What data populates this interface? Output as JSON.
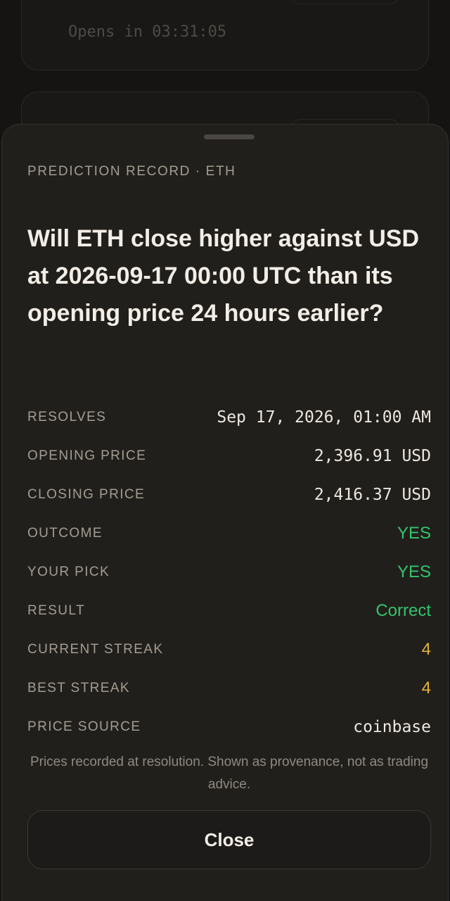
{
  "background": {
    "card1_timer": "Opens in 03:31:05"
  },
  "sheet": {
    "eyebrow": "PREDICTION RECORD · ETH",
    "question": "Will ETH close higher against USD at 2026-09-17 00:00 UTC than its opening price 24 hours earlier?",
    "rows": [
      {
        "label": "RESOLVES",
        "value": "Sep 17, 2026, 01:00 AM"
      },
      {
        "label": "OPENING PRICE",
        "value": "2,396.91 USD"
      },
      {
        "label": "CLOSING PRICE",
        "value": "2,416.37 USD"
      },
      {
        "label": "OUTCOME",
        "value": "YES"
      },
      {
        "label": "YOUR PICK",
        "value": "YES"
      },
      {
        "label": "RESULT",
        "value": "Correct"
      },
      {
        "label": "CURRENT STREAK",
        "value": "4"
      },
      {
        "label": "BEST STREAK",
        "value": "4"
      },
      {
        "label": "PRICE SOURCE",
        "value": "coinbase"
      }
    ],
    "note": "Prices recorded at resolution. Shown as provenance, not as trading advice.",
    "close_label": "Close"
  },
  "colors": {
    "positive": "#34c46b",
    "streak": "#e3b23c",
    "sheet_bg": "#211f1c"
  }
}
